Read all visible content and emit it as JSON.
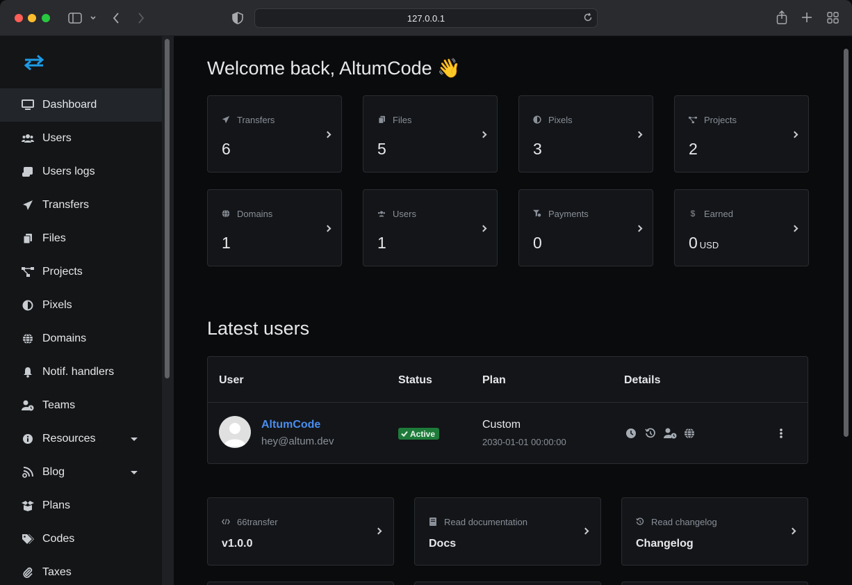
{
  "browser": {
    "url": "127.0.0.1"
  },
  "sidebar": {
    "items": [
      {
        "label": "Dashboard",
        "icon": "monitor-icon",
        "active": true
      },
      {
        "label": "Users",
        "icon": "users-icon"
      },
      {
        "label": "Users logs",
        "icon": "scroll-icon"
      },
      {
        "label": "Transfers",
        "icon": "paper-plane-icon"
      },
      {
        "label": "Files",
        "icon": "copy-icon"
      },
      {
        "label": "Projects",
        "icon": "project-diagram-icon"
      },
      {
        "label": "Pixels",
        "icon": "adjust-icon"
      },
      {
        "label": "Domains",
        "icon": "globe-icon"
      },
      {
        "label": "Notif. handlers",
        "icon": "bell-icon"
      },
      {
        "label": "Teams",
        "icon": "user-clock-icon"
      },
      {
        "label": "Resources",
        "icon": "info-circle-icon",
        "has_dropdown": true
      },
      {
        "label": "Blog",
        "icon": "blog-icon",
        "has_dropdown": true
      },
      {
        "label": "Plans",
        "icon": "box-open-icon"
      },
      {
        "label": "Codes",
        "icon": "tags-icon"
      },
      {
        "label": "Taxes",
        "icon": "paperclip-icon"
      }
    ]
  },
  "main": {
    "welcome": "Welcome back, AltumCode 👋",
    "stats": [
      {
        "label": "Transfers",
        "value": "6",
        "icon": "paper-plane-icon"
      },
      {
        "label": "Files",
        "value": "5",
        "icon": "copy-icon"
      },
      {
        "label": "Pixels",
        "value": "3",
        "icon": "adjust-icon"
      },
      {
        "label": "Projects",
        "value": "2",
        "icon": "project-diagram-icon"
      },
      {
        "label": "Domains",
        "value": "1",
        "icon": "globe-icon"
      },
      {
        "label": "Users",
        "value": "1",
        "icon": "users-icon"
      },
      {
        "label": "Payments",
        "value": "0",
        "icon": "funnel-dollar-icon"
      },
      {
        "label": "Earned",
        "value": "0",
        "unit": "USD",
        "icon": "dollar-icon"
      }
    ],
    "latest_users": {
      "title": "Latest users",
      "columns": [
        "User",
        "Status",
        "Plan",
        "Details"
      ],
      "rows": [
        {
          "name": "AltumCode",
          "email": "hey@altum.dev",
          "status": "Active",
          "plan": "Custom",
          "plan_expiry": "2030-01-01 00:00:00"
        }
      ]
    },
    "info_cards": [
      {
        "label": "66transfer",
        "value": "v1.0.0",
        "icon": "code-icon"
      },
      {
        "label": "Read documentation",
        "value": "Docs",
        "icon": "book-icon"
      },
      {
        "label": "Read changelog",
        "value": "Changelog",
        "icon": "history-icon"
      }
    ]
  },
  "colors": {
    "background": "#0a0b0c",
    "sidebar": "#131517",
    "card": "#131518",
    "link": "#4a8df0",
    "badge_active": "#1e7b3a"
  }
}
